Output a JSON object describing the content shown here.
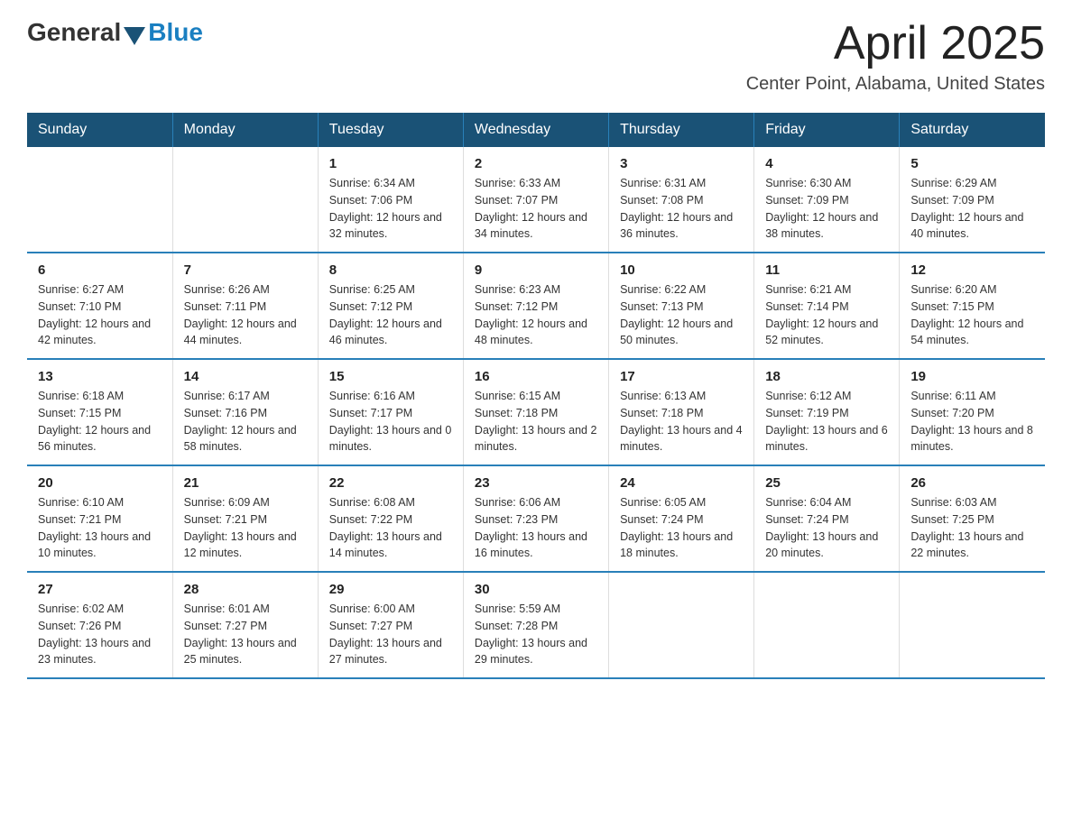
{
  "header": {
    "logo": {
      "general": "General",
      "blue": "Blue"
    },
    "title": "April 2025",
    "location": "Center Point, Alabama, United States"
  },
  "weekdays": [
    "Sunday",
    "Monday",
    "Tuesday",
    "Wednesday",
    "Thursday",
    "Friday",
    "Saturday"
  ],
  "weeks": [
    [
      {
        "day": "",
        "info": ""
      },
      {
        "day": "",
        "info": ""
      },
      {
        "day": "1",
        "info": "Sunrise: 6:34 AM\nSunset: 7:06 PM\nDaylight: 12 hours\nand 32 minutes."
      },
      {
        "day": "2",
        "info": "Sunrise: 6:33 AM\nSunset: 7:07 PM\nDaylight: 12 hours\nand 34 minutes."
      },
      {
        "day": "3",
        "info": "Sunrise: 6:31 AM\nSunset: 7:08 PM\nDaylight: 12 hours\nand 36 minutes."
      },
      {
        "day": "4",
        "info": "Sunrise: 6:30 AM\nSunset: 7:09 PM\nDaylight: 12 hours\nand 38 minutes."
      },
      {
        "day": "5",
        "info": "Sunrise: 6:29 AM\nSunset: 7:09 PM\nDaylight: 12 hours\nand 40 minutes."
      }
    ],
    [
      {
        "day": "6",
        "info": "Sunrise: 6:27 AM\nSunset: 7:10 PM\nDaylight: 12 hours\nand 42 minutes."
      },
      {
        "day": "7",
        "info": "Sunrise: 6:26 AM\nSunset: 7:11 PM\nDaylight: 12 hours\nand 44 minutes."
      },
      {
        "day": "8",
        "info": "Sunrise: 6:25 AM\nSunset: 7:12 PM\nDaylight: 12 hours\nand 46 minutes."
      },
      {
        "day": "9",
        "info": "Sunrise: 6:23 AM\nSunset: 7:12 PM\nDaylight: 12 hours\nand 48 minutes."
      },
      {
        "day": "10",
        "info": "Sunrise: 6:22 AM\nSunset: 7:13 PM\nDaylight: 12 hours\nand 50 minutes."
      },
      {
        "day": "11",
        "info": "Sunrise: 6:21 AM\nSunset: 7:14 PM\nDaylight: 12 hours\nand 52 minutes."
      },
      {
        "day": "12",
        "info": "Sunrise: 6:20 AM\nSunset: 7:15 PM\nDaylight: 12 hours\nand 54 minutes."
      }
    ],
    [
      {
        "day": "13",
        "info": "Sunrise: 6:18 AM\nSunset: 7:15 PM\nDaylight: 12 hours\nand 56 minutes."
      },
      {
        "day": "14",
        "info": "Sunrise: 6:17 AM\nSunset: 7:16 PM\nDaylight: 12 hours\nand 58 minutes."
      },
      {
        "day": "15",
        "info": "Sunrise: 6:16 AM\nSunset: 7:17 PM\nDaylight: 13 hours\nand 0 minutes."
      },
      {
        "day": "16",
        "info": "Sunrise: 6:15 AM\nSunset: 7:18 PM\nDaylight: 13 hours\nand 2 minutes."
      },
      {
        "day": "17",
        "info": "Sunrise: 6:13 AM\nSunset: 7:18 PM\nDaylight: 13 hours\nand 4 minutes."
      },
      {
        "day": "18",
        "info": "Sunrise: 6:12 AM\nSunset: 7:19 PM\nDaylight: 13 hours\nand 6 minutes."
      },
      {
        "day": "19",
        "info": "Sunrise: 6:11 AM\nSunset: 7:20 PM\nDaylight: 13 hours\nand 8 minutes."
      }
    ],
    [
      {
        "day": "20",
        "info": "Sunrise: 6:10 AM\nSunset: 7:21 PM\nDaylight: 13 hours\nand 10 minutes."
      },
      {
        "day": "21",
        "info": "Sunrise: 6:09 AM\nSunset: 7:21 PM\nDaylight: 13 hours\nand 12 minutes."
      },
      {
        "day": "22",
        "info": "Sunrise: 6:08 AM\nSunset: 7:22 PM\nDaylight: 13 hours\nand 14 minutes."
      },
      {
        "day": "23",
        "info": "Sunrise: 6:06 AM\nSunset: 7:23 PM\nDaylight: 13 hours\nand 16 minutes."
      },
      {
        "day": "24",
        "info": "Sunrise: 6:05 AM\nSunset: 7:24 PM\nDaylight: 13 hours\nand 18 minutes."
      },
      {
        "day": "25",
        "info": "Sunrise: 6:04 AM\nSunset: 7:24 PM\nDaylight: 13 hours\nand 20 minutes."
      },
      {
        "day": "26",
        "info": "Sunrise: 6:03 AM\nSunset: 7:25 PM\nDaylight: 13 hours\nand 22 minutes."
      }
    ],
    [
      {
        "day": "27",
        "info": "Sunrise: 6:02 AM\nSunset: 7:26 PM\nDaylight: 13 hours\nand 23 minutes."
      },
      {
        "day": "28",
        "info": "Sunrise: 6:01 AM\nSunset: 7:27 PM\nDaylight: 13 hours\nand 25 minutes."
      },
      {
        "day": "29",
        "info": "Sunrise: 6:00 AM\nSunset: 7:27 PM\nDaylight: 13 hours\nand 27 minutes."
      },
      {
        "day": "30",
        "info": "Sunrise: 5:59 AM\nSunset: 7:28 PM\nDaylight: 13 hours\nand 29 minutes."
      },
      {
        "day": "",
        "info": ""
      },
      {
        "day": "",
        "info": ""
      },
      {
        "day": "",
        "info": ""
      }
    ]
  ]
}
